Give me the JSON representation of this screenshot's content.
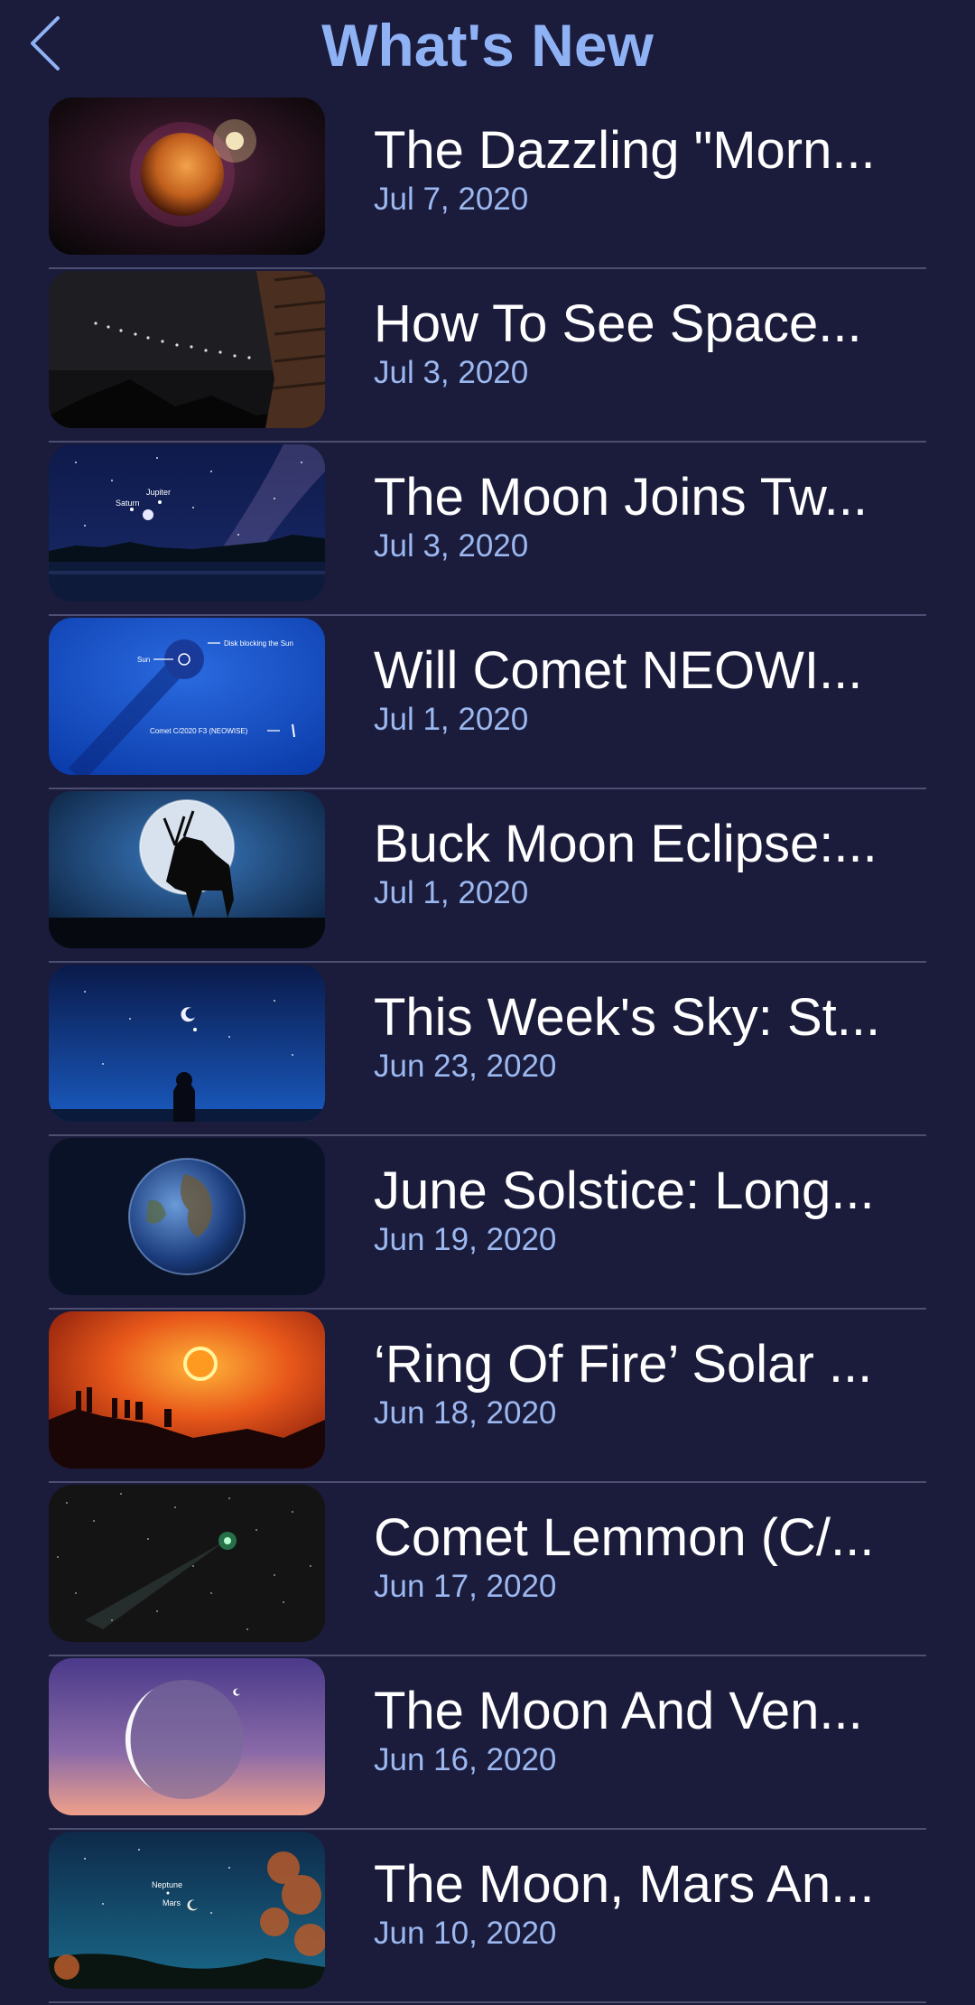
{
  "header": {
    "title": "What's New",
    "back_icon": "chevron-left-icon"
  },
  "colors": {
    "background": "#1b1b3b",
    "title": "#8fb2f5",
    "item_title": "#ffffff",
    "item_date": "#9bb8f0",
    "divider": "#4d4f72"
  },
  "articles": [
    {
      "title": "The Dazzling \"Morn...",
      "date": "Jul 7, 2020",
      "thumb": "venus-planet"
    },
    {
      "title": "How To See Space...",
      "date": "Jul 3, 2020",
      "thumb": "starlink-trail"
    },
    {
      "title": "The Moon Joins Tw...",
      "date": "Jul 3, 2020",
      "thumb": "milky-way-lake",
      "labels": [
        "Jupiter",
        "Saturn"
      ]
    },
    {
      "title": "Will Comet NEOWI...",
      "date": "Jul 1, 2020",
      "thumb": "soho-comet",
      "labels": [
        "Sun",
        "Disk blocking the Sun",
        "Comet C/2020 F3 (NEOWISE)"
      ]
    },
    {
      "title": "Buck Moon Eclipse:...",
      "date": "Jul 1, 2020",
      "thumb": "deer-moon"
    },
    {
      "title": "This Week's Sky: St...",
      "date": "Jun 23, 2020",
      "thumb": "night-sky-person"
    },
    {
      "title": "June Solstice: Long...",
      "date": "Jun 19, 2020",
      "thumb": "earth-globe"
    },
    {
      "title": "‘Ring Of Fire’ Solar ...",
      "date": "Jun 18, 2020",
      "thumb": "solar-eclipse"
    },
    {
      "title": "Comet Lemmon (C/...",
      "date": "Jun 17, 2020",
      "thumb": "green-comet"
    },
    {
      "title": "The Moon And Ven...",
      "date": "Jun 16, 2020",
      "thumb": "crescent-moon"
    },
    {
      "title": "The Moon, Mars An...",
      "date": "Jun 10, 2020",
      "thumb": "moon-mars-neptune",
      "labels": [
        "Neptune",
        "Mars"
      ]
    }
  ]
}
